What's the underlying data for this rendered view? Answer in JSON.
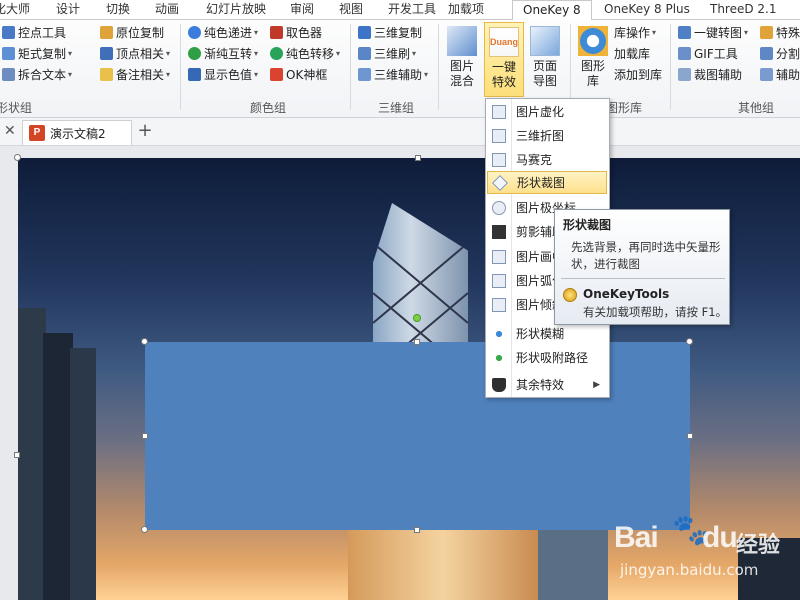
{
  "tabs": [
    "化大师",
    "设计",
    "切换",
    "动画",
    "幻灯片放映",
    "审阅",
    "视图",
    "开发工具",
    "加载项",
    "OneKey 8",
    "OneKey 8 Plus",
    "ThreeD 2.1"
  ],
  "ribbon": {
    "groups": {
      "shape": {
        "label": "形状组",
        "items": [
          "控点工具",
          "原位复制",
          "矩式复制",
          "顶点相关",
          "拆合文本",
          "备注相关"
        ]
      },
      "color": {
        "label": "颜色组",
        "items": [
          "纯色递进",
          "取色器",
          "渐纯互转",
          "纯色转移",
          "显示色值",
          "OK神框"
        ]
      },
      "three_d": {
        "label": "三维组",
        "items": [
          "三维复制",
          "三维刷",
          "三维辅助"
        ]
      },
      "image": {
        "items": [
          "图片\n混合",
          "一键\n特效",
          "页面\n导图"
        ],
        "duang_badge": "Duang"
      },
      "library": {
        "label": "图形库",
        "big_label": "图形\n库",
        "items": [
          "库操作",
          "加载库",
          "添加到库"
        ]
      },
      "other": {
        "label": "其他组",
        "items": [
          "一键转图",
          "特殊",
          "GIF工具",
          "分割",
          "裁图辅助",
          "辅助"
        ]
      }
    }
  },
  "document": {
    "close_glyph": "✕",
    "tab_label": "演示文稿2",
    "file_badge": "P",
    "new_tab_glyph": "+"
  },
  "menu": {
    "items": [
      "图片虚化",
      "三维折图",
      "马赛克",
      "形状裁图",
      "图片极坐标",
      "剪影辅助",
      "图片画中画",
      "图片弧化",
      "图片倾斜",
      "形状模糊",
      "形状吸附路径",
      "其余特效"
    ],
    "highlighted": "形状裁图"
  },
  "tooltip": {
    "title": "形状裁图",
    "description": "先选背景，再同时选中矢量形状，进行裁图",
    "footer_title": "OneKeyTools",
    "footer_help": "有关加载项帮助，请按 F1。"
  },
  "watermark": {
    "brand": "Bai",
    "suffix": "du",
    "product": "经验",
    "url": "jingyan.baidu.com"
  },
  "colors": {
    "shape_fill": "#4f81bd",
    "pressed_button": "#fde08c",
    "accent_tab": "#d24625"
  }
}
